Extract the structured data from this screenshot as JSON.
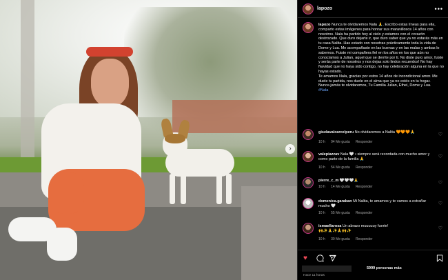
{
  "post": {
    "username": "lapozo",
    "more_icon": "more-horizontal-icon",
    "caption": {
      "username": "lapozo",
      "text": "Nunca te olvidaremos Nala 🙏. Escribo estas líneas para ella, comparto estas imágenes para honrar sus maravillosos 14 años con nosotros. Nala ha partido hoy al cielo y estamos con el corazón destrozado. Que duro dejarte ir, que duro saber que ya no estarás más en tu casa Nalita. Has estado con nosotras prácticamente toda la vida de Dome y Lua. Me acompañaste en las buenas y en las malas y ambas lo sabemos. Fuiste mi compañera fiel en los años en los que aún no conocíamos a Julian, aquel que se derrite por ti. No diste puro amor, fuiste y serás parte de nosotros y nos dejas solo lindos recuerdos! No hay Navidad que no haya sido contigo, no hay celebración alguna en la que no hayas estado.",
      "text2": "Te amamos Nala, gracias por estos 14 años de incondicional amor. Me duele tu partida, nos duele en el alma que ya no estés en tu hogar.",
      "text3": "Nunca jamás te olvidaremos, Tu Familia Julian, Ethel, Dome y Lua.",
      "hashtag": "#Nala"
    },
    "comments": [
      {
        "user": "giselavalcarcelperu",
        "text": "No olvidaremos a Nalita 🧡🧡🧡🙏",
        "time": "10 h",
        "likes": "94 Me gusta",
        "reply": "Responder"
      },
      {
        "user": "valepiazzav",
        "text": "Nala 🤍 • siempre será recordada con mucho amor y como parte de la familia 🙏",
        "time": "10 h",
        "likes": "54 Me gusta",
        "reply": "Responder"
      },
      {
        "user": "pierre_c_m",
        "text": "🤍🤍🤍🙏",
        "time": "10 h",
        "likes": "14 Me gusta",
        "reply": "Responder"
      },
      {
        "user": "domenica.garaban",
        "text": "Mi Nalita, te amamos y te vamos a extrañar mucho 🤍",
        "time": "10 h",
        "likes": "55 Me gusta",
        "reply": "Responder"
      },
      {
        "user": "ismaellarosa",
        "text": "Un abrazo muuuuuy fuerte!",
        "text2": "🙌✨🙏✨🙏🙌✨",
        "time": "10 h",
        "likes": "30 Me gusta",
        "reply": "Responder"
      }
    ],
    "likes_text": "5999 personas más",
    "timestamp": "Hace 11 horas",
    "icons": {
      "like": "heart-filled-icon",
      "comment": "comment-icon",
      "share": "send-icon",
      "save": "bookmark-icon",
      "next": "chevron-right-icon"
    },
    "colors": {
      "like_red": "#ed4956",
      "link_blue": "#6ea8ff"
    }
  }
}
